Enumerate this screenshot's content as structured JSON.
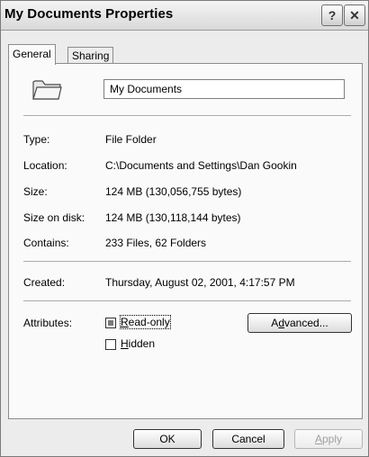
{
  "window": {
    "title": "My Documents Properties",
    "help_glyph": "?",
    "close_glyph": "✕"
  },
  "tabs": [
    {
      "label": "General",
      "active": true
    },
    {
      "label": "Sharing",
      "active": false
    }
  ],
  "general": {
    "name_value": "My Documents",
    "icon": "folder-icon",
    "rows": [
      {
        "label": "Type:",
        "value": "File Folder"
      },
      {
        "label": "Location:",
        "value": "C:\\Documents and Settings\\Dan Gookin"
      },
      {
        "label": "Size:",
        "value": "124 MB (130,056,755 bytes)"
      },
      {
        "label": "Size on disk:",
        "value": "124 MB (130,118,144 bytes)"
      },
      {
        "label": "Contains:",
        "value": "233 Files, 62 Folders"
      }
    ],
    "created": {
      "label": "Created:",
      "value": "Thursday, August 02, 2001, 4:17:57 PM"
    },
    "attributes": {
      "label": "Attributes:",
      "readonly": {
        "accel": "R",
        "rest": "ead-only",
        "state": "indeterminate"
      },
      "hidden": {
        "accel": "H",
        "rest": "idden",
        "state": "unchecked"
      },
      "advanced": {
        "pre": "A",
        "accel": "d",
        "rest": "vanced..."
      }
    }
  },
  "buttons": {
    "ok": "OK",
    "cancel": "Cancel",
    "apply": {
      "accel": "A",
      "rest": "pply",
      "enabled": false
    }
  }
}
